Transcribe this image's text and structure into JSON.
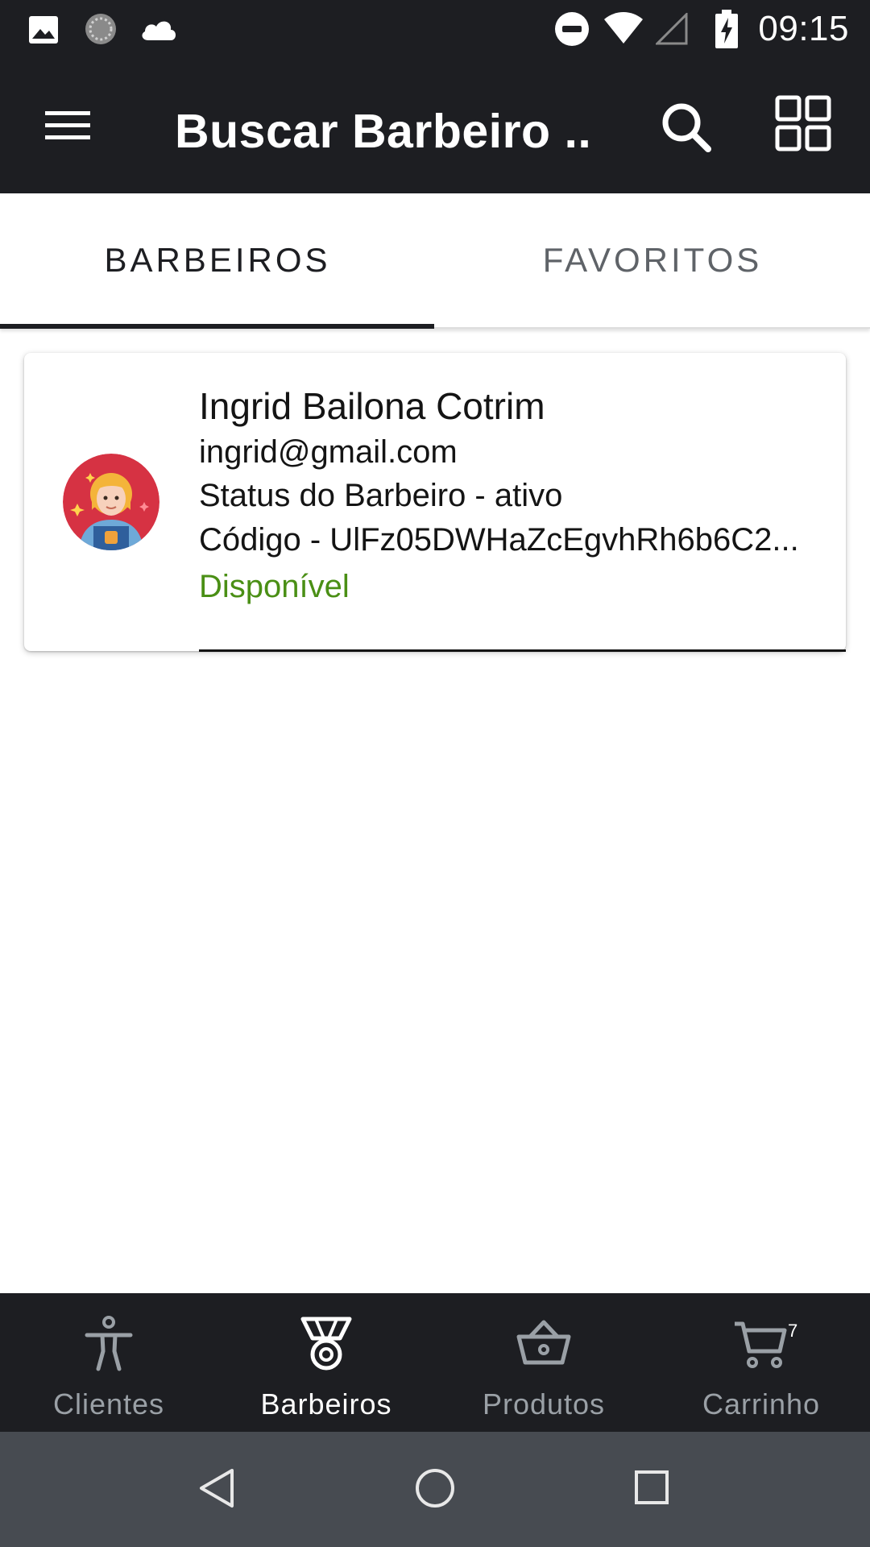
{
  "status_bar": {
    "time": "09:15",
    "left_icons": [
      "image-icon",
      "loading-icon",
      "cloud-icon"
    ],
    "right_icons": [
      "do-not-disturb-icon",
      "wifi-icon",
      "cell-signal-icon",
      "battery-charging-icon"
    ]
  },
  "app_bar": {
    "title": "Buscar Barbeiro ...",
    "icons": [
      "menu-icon",
      "search-icon",
      "grid-view-icon"
    ]
  },
  "tabs": [
    {
      "label": "BARBEIROS",
      "active": true
    },
    {
      "label": "FAVORITOS",
      "active": false
    }
  ],
  "barber_card": {
    "name": "Ingrid Bailona Cotrim",
    "email": "ingrid@gmail.com",
    "status": "Status do Barbeiro - ativo",
    "code": "Código - UlFz05DWHaZcEgvhRh6b6C2...",
    "availability": "Disponível"
  },
  "bottom_nav": {
    "items": [
      {
        "label": "Clientes",
        "icon": "person-accessibility-icon",
        "active": false
      },
      {
        "label": "Barbeiros",
        "icon": "medal-icon",
        "active": true
      },
      {
        "label": "Produtos",
        "icon": "basket-icon",
        "active": false
      },
      {
        "label": "Carrinho",
        "icon": "cart-icon",
        "active": false,
        "badge": "7"
      }
    ]
  },
  "system_nav": [
    "back-icon",
    "home-icon",
    "recents-icon"
  ],
  "colors": {
    "bar_background": "#1d1e22",
    "available_green": "#4a8f15",
    "system_nav_background": "#474b51",
    "inactive_nav": "#9aa0a6"
  }
}
